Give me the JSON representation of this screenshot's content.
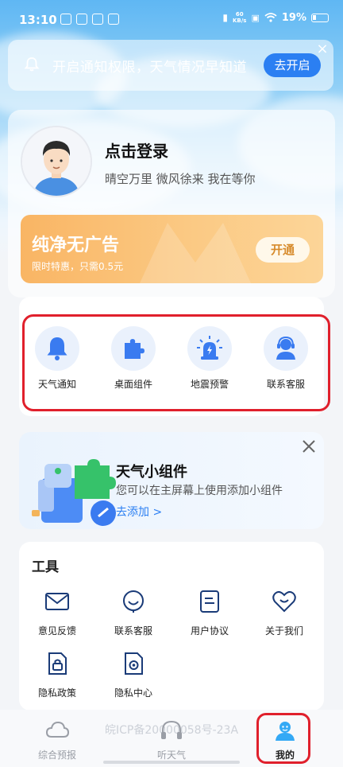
{
  "status_bar": {
    "time": "13:10",
    "net_speed_value": "60",
    "net_speed_unit": "KB/s",
    "battery": "19%"
  },
  "notification": {
    "text": "开启通知权限，天气情况早知道",
    "button": "去开启",
    "close": "×"
  },
  "profile": {
    "title": "点击登录",
    "subtitle": "晴空万里 微风徐来 我在等你"
  },
  "vip": {
    "title": "纯净无广告",
    "subtitle": "限时特惠，只需0.5元",
    "button": "开通"
  },
  "quick_actions": [
    {
      "label": "天气通知",
      "icon": "bell-icon"
    },
    {
      "label": "桌面组件",
      "icon": "puzzle-icon"
    },
    {
      "label": "地震预警",
      "icon": "alarm-icon"
    },
    {
      "label": "联系客服",
      "icon": "customer-service-icon"
    }
  ],
  "widget_promo": {
    "title": "天气小组件",
    "description": "您可以在主屏幕上使用添加小组件",
    "link": "去添加 >"
  },
  "tools": {
    "title": "工具",
    "items": [
      {
        "label": "意见反馈",
        "icon": "mail-icon"
      },
      {
        "label": "联系客服",
        "icon": "headset-smile-icon"
      },
      {
        "label": "用户协议",
        "icon": "document-icon"
      },
      {
        "label": "关于我们",
        "icon": "heart-icon"
      },
      {
        "label": "隐私政策",
        "icon": "lock-doc-icon"
      },
      {
        "label": "隐私中心",
        "icon": "gear-doc-icon"
      }
    ]
  },
  "footer": {
    "icp": "皖ICP备20000058号-23A"
  },
  "bottom_nav": [
    {
      "label": "综合预报",
      "icon": "cloud-icon",
      "active": false
    },
    {
      "label": "听天气",
      "icon": "headphones-icon",
      "active": false
    },
    {
      "label": "我的",
      "icon": "user-icon",
      "active": true
    }
  ],
  "colors": {
    "accent": "#2b7ff2",
    "highlight": "#e0202c",
    "vip_orange": "#f9b564"
  }
}
